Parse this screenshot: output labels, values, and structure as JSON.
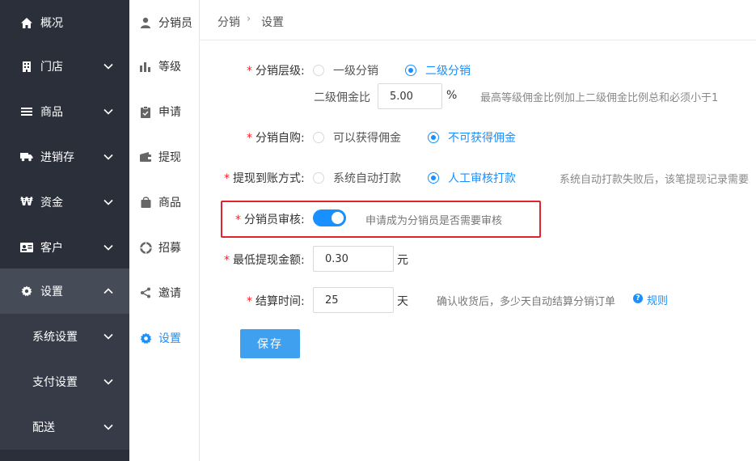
{
  "nav": {
    "items": [
      {
        "label": "概况",
        "icon": "home-icon"
      },
      {
        "label": "门店",
        "icon": "store-icon"
      },
      {
        "label": "商品",
        "icon": "list-icon"
      },
      {
        "label": "进销存",
        "icon": "truck-icon"
      },
      {
        "label": "资金",
        "icon": "yen-icon"
      },
      {
        "label": "客户",
        "icon": "id-card-icon"
      },
      {
        "label": "设置",
        "icon": "gear-icon"
      }
    ],
    "sub_items": [
      {
        "label": "系统设置"
      },
      {
        "label": "支付设置"
      },
      {
        "label": "配送"
      }
    ]
  },
  "subnav": {
    "items": [
      {
        "label": "分销员",
        "icon": "user-icon"
      },
      {
        "label": "等级",
        "icon": "bar-chart-icon"
      },
      {
        "label": "申请",
        "icon": "clipboard-icon"
      },
      {
        "label": "提现",
        "icon": "wallet-icon"
      },
      {
        "label": "商品",
        "icon": "bag-icon"
      },
      {
        "label": "招募",
        "icon": "lifebuoy-icon"
      },
      {
        "label": "邀请",
        "icon": "share-icon"
      },
      {
        "label": "设置",
        "icon": "gear-icon"
      }
    ]
  },
  "breadcrumb": {
    "first": "分销",
    "separator": "›",
    "second": "设置"
  },
  "form": {
    "level": {
      "label": "分销层级:",
      "options": [
        "一级分销",
        "二级分销"
      ],
      "selected": "二级分销",
      "commission_label": "二级佣金比",
      "commission_value": "5.00",
      "commission_unit": "%",
      "commission_hint": "最高等级佣金比例加上二级佣金比例总和必须小于1"
    },
    "self_buy": {
      "label": "分销自购:",
      "options": [
        "可以获得佣金",
        "不可获得佣金"
      ],
      "selected": "不可获得佣金"
    },
    "withdraw_method": {
      "label": "提现到账方式:",
      "options": [
        "系统自动打款",
        "人工审核打款"
      ],
      "selected": "人工审核打款",
      "hint": "系统自动打款失败后，该笔提现记录需要"
    },
    "review": {
      "label": "分销员审核:",
      "enabled": true,
      "hint": "申请成为分销员是否需要审核"
    },
    "min_withdraw": {
      "label": "最低提现金额:",
      "value": "0.30",
      "unit": "元"
    },
    "settle_time": {
      "label": "结算时间:",
      "value": "25",
      "unit": "天",
      "hint": "确认收货后，多少天自动结算分销订单",
      "help_icon": "?",
      "link": "规则"
    },
    "save_label": "保存"
  },
  "colors": {
    "accent": "#1890ff",
    "nav_bg": "#2b2f3a",
    "highlight": "#e0232d",
    "save_button": "#40a0f0"
  }
}
